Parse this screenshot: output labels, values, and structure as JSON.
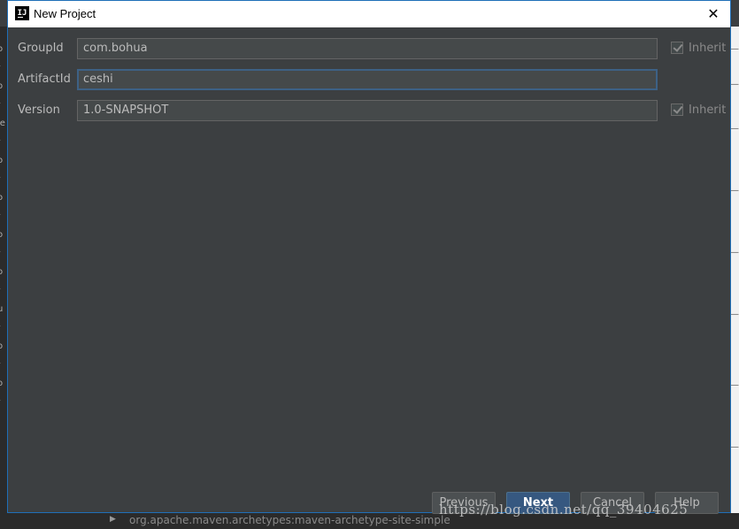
{
  "window": {
    "title": "New Project",
    "app_icon": "intellij-icon",
    "close_icon": "close-icon"
  },
  "form": {
    "groupid": {
      "label": "GroupId",
      "value": "com.bohua",
      "inherit_label": "Inherit",
      "inherit_checked": true
    },
    "artifactid": {
      "label": "ArtifactId",
      "value": "ceshi"
    },
    "version": {
      "label": "Version",
      "value": "1.0-SNAPSHOT",
      "inherit_label": "Inherit",
      "inherit_checked": true
    }
  },
  "buttons": {
    "previous": "Previous",
    "next": "Next",
    "cancel": "Cancel",
    "help": "Help"
  },
  "watermark": "https://blog.csdn.net/qq_39404625",
  "background": {
    "bottom_crumb": "org.apache.maven.archetypes:maven-archetype-site-simple"
  },
  "colors": {
    "dialog_bg": "#3c3f41",
    "primary_button": "#365880",
    "focus_border": "#3d6185"
  }
}
